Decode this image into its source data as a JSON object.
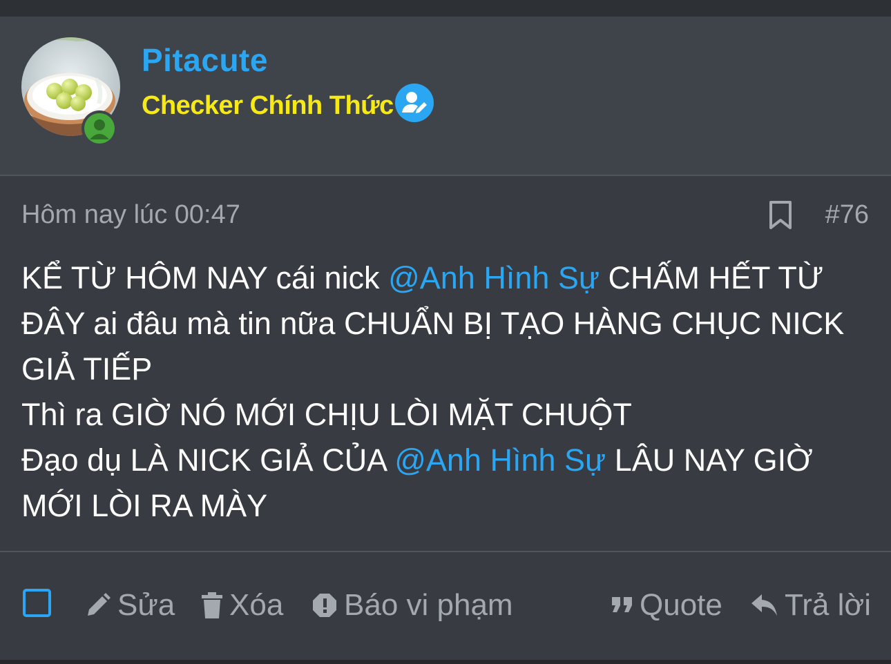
{
  "user": {
    "name": "Pitacute",
    "title": "Checker Chính Thức",
    "name_color": "#2aa6f2",
    "title_color": "#f7ea14",
    "status": "online"
  },
  "post": {
    "timestamp": "Hôm nay lúc 00:47",
    "number": "#76",
    "message": {
      "line1_a": "KỂ TỪ HÔM NAY cái nick ",
      "mention1": "@Anh Hình Sự",
      "line1_b": " CHẤM HẾT TỪ",
      "line2": "ĐÂY ai đâu mà tin nữa CHUẨN BỊ TẠO HÀNG CHỤC NICK",
      "line3": "GIẢ TIẾP",
      "line4": "Thì ra GIỜ NÓ MỚI CHỊU LÒI MẶT CHUỘT",
      "line5_a": "Đạo dụ LÀ NICK GIẢ CỦA ",
      "mention2": "@Anh Hình Sự",
      "line5_b": " LÂU NAY GIỜ",
      "line6": "MỚI LÒI RA MÀY"
    }
  },
  "actions": {
    "edit": "Sửa",
    "delete": "Xóa",
    "report": "Báo vi phạm",
    "quote": "Quote",
    "reply": "Trả lời"
  },
  "icons": {
    "verified": "user-edit-icon",
    "bookmark": "bookmark-icon",
    "edit": "pencil-icon",
    "delete": "trash-icon",
    "report": "alert-octagon-icon",
    "quote": "quote-icon",
    "reply": "reply-icon",
    "online": "person-icon"
  },
  "colors": {
    "accent": "#2aa6f2",
    "muted_text": "#a4a8af",
    "background": "#383b42",
    "header_background": "#3f434a",
    "online": "#48a83c"
  }
}
